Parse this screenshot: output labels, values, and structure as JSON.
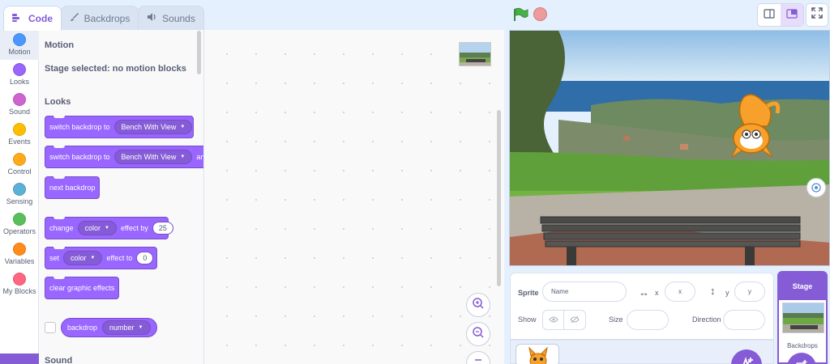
{
  "tabs": [
    {
      "label": "Code",
      "icon": "code-icon"
    },
    {
      "label": "Backdrops",
      "icon": "brush-icon"
    },
    {
      "label": "Sounds",
      "icon": "speaker-icon"
    }
  ],
  "categories": [
    {
      "label": "Motion",
      "color": "#4c97ff"
    },
    {
      "label": "Looks",
      "color": "#9966ff"
    },
    {
      "label": "Sound",
      "color": "#cf63cf"
    },
    {
      "label": "Events",
      "color": "#ffbf00"
    },
    {
      "label": "Control",
      "color": "#ffab19"
    },
    {
      "label": "Sensing",
      "color": "#5cb1d6"
    },
    {
      "label": "Operators",
      "color": "#59c059"
    },
    {
      "label": "Variables",
      "color": "#ff8c1a"
    },
    {
      "label": "My Blocks",
      "color": "#ff6680"
    }
  ],
  "palette": {
    "motion_heading": "Motion",
    "motion_empty": "Stage selected: no motion blocks",
    "looks_heading": "Looks",
    "sound_heading": "Sound",
    "blocks": {
      "switch_backdrop": {
        "text": "switch backdrop to",
        "value": "Bench With View"
      },
      "switch_backdrop_wait": {
        "text": "switch backdrop to",
        "value": "Bench With View",
        "suffix": "and"
      },
      "next_backdrop": {
        "text": "next backdrop"
      },
      "change_effect": {
        "prefix": "change",
        "effect": "color",
        "middle": "effect by",
        "value": "25"
      },
      "set_effect": {
        "prefix": "set",
        "effect": "color",
        "middle": "effect to",
        "value": "0"
      },
      "clear_effects": {
        "text": "clear graphic effects"
      },
      "backdrop_reporter": {
        "text": "backdrop",
        "value": "number"
      }
    }
  },
  "sprite_info": {
    "sprite_label": "Sprite",
    "name_placeholder": "Name",
    "x_label": "x",
    "x_placeholder": "x",
    "y_label": "y",
    "y_placeholder": "y",
    "show_label": "Show",
    "size_label": "Size",
    "direction_label": "Direction"
  },
  "stage_panel": {
    "title": "Stage",
    "backdrops_label": "Backdrops"
  },
  "colors": {
    "accent": "#855cd6",
    "looks_block": "#9966ff",
    "background": "#e5f0ff"
  }
}
